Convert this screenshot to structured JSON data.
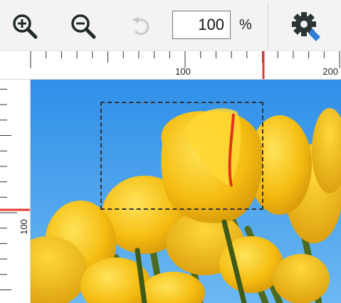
{
  "toolbar": {
    "zoom_in_label": "Zoom in",
    "zoom_out_label": "Zoom out",
    "undo_label": "Undo",
    "zoom_value": "100",
    "zoom_unit": "%",
    "settings_label": "Settings"
  },
  "rulers": {
    "top_labels": [
      "100",
      "200"
    ],
    "left_labels": [
      "100"
    ]
  },
  "colors": {
    "marker": "#e53935",
    "sky": "#3b98e6",
    "tulip": "#f2b90f",
    "stem": "#4d6b1f"
  },
  "icons": {
    "zoom_in": "zoom-in-icon",
    "zoom_out": "zoom-out-icon",
    "undo": "undo-icon",
    "settings": "settings-gear-icon"
  }
}
